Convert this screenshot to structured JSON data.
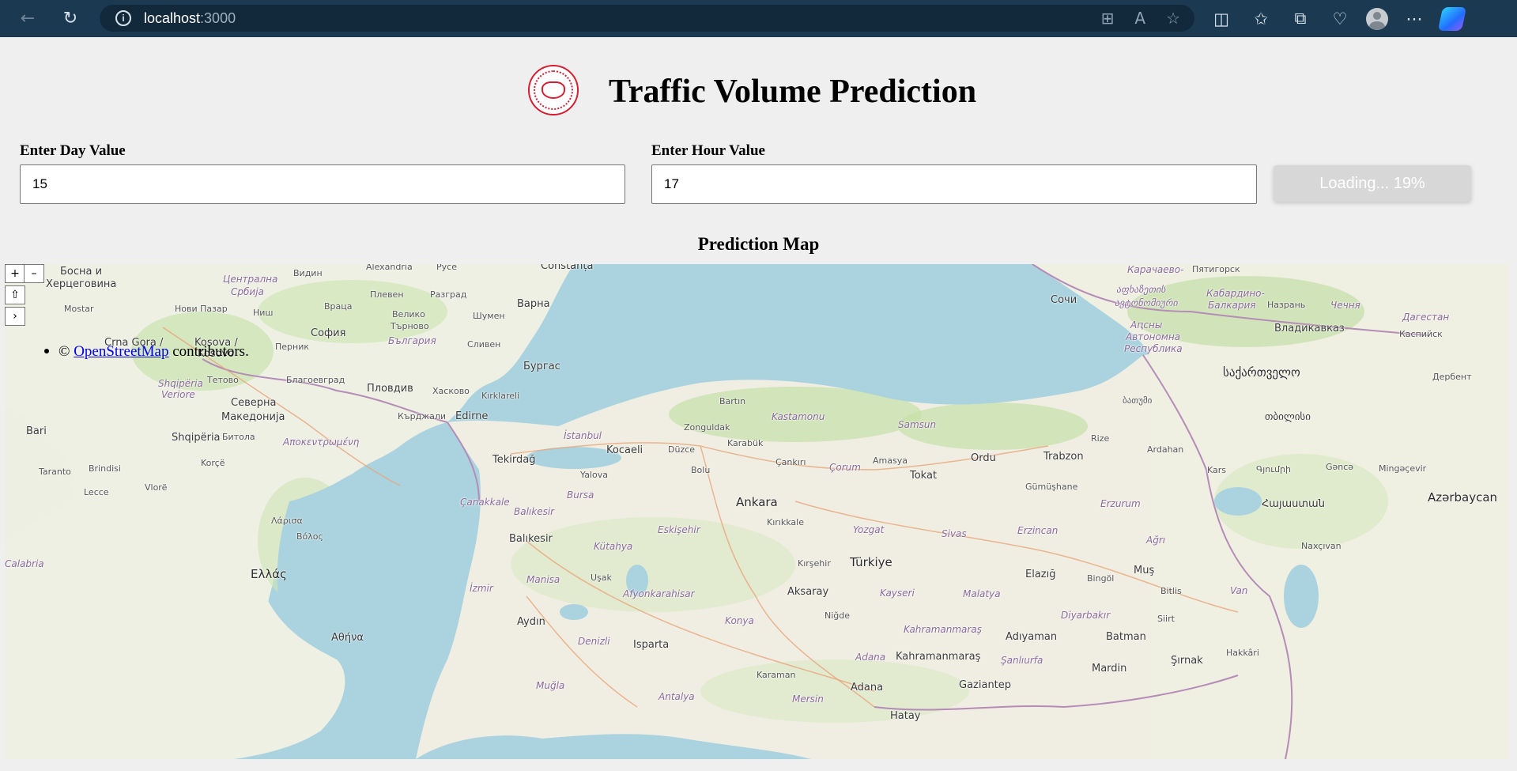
{
  "browser": {
    "url_host": "localhost",
    "url_port": ":3000",
    "icons": [
      "back-icon",
      "reload-icon",
      "site-info-icon",
      "apps-icon",
      "read-aloud-icon",
      "favorite-star-icon",
      "split-screen-icon",
      "favorites-icon",
      "collections-icon",
      "browser-essentials-icon",
      "profile-icon",
      "more-icon",
      "copilot-icon"
    ]
  },
  "header": {
    "title": "Traffic Volume Prediction"
  },
  "form": {
    "day_label": "Enter Day Value",
    "day_value": "15",
    "hour_label": "Enter Hour Value",
    "hour_value": "17",
    "button_label": "Loading... 19%",
    "progress_percent": 19
  },
  "map": {
    "heading": "Prediction Map",
    "zoom_in": "+",
    "zoom_out": "–",
    "reset": "⇧",
    "expand": "›",
    "attribution_prefix": "©",
    "attribution_link": "OpenStreetMap",
    "attribution_suffix": "contributors.",
    "places": [
      {
        "id": "bosna",
        "text": "Босна и",
        "cls": "med"
      },
      {
        "id": "hercegovina",
        "text": "Херцеговина",
        "cls": "med"
      },
      {
        "id": "centralna-srbija",
        "text": "Централна",
        "cls": "region"
      },
      {
        "id": "srbija",
        "text": "Србија",
        "cls": "region"
      },
      {
        "id": "vidin",
        "text": "Видин",
        "cls": "small"
      },
      {
        "id": "alexandria",
        "text": "Alexandria",
        "cls": "small"
      },
      {
        "id": "ruse",
        "text": "Русе",
        "cls": "small"
      },
      {
        "id": "constanta",
        "text": "Constanța",
        "cls": "med"
      },
      {
        "id": "mostar",
        "text": "Mostar",
        "cls": "small"
      },
      {
        "id": "novi-pazar",
        "text": "Нови Пазар",
        "cls": "small"
      },
      {
        "id": "nis",
        "text": "Ниш",
        "cls": "small"
      },
      {
        "id": "vraca",
        "text": "Враца",
        "cls": "small"
      },
      {
        "id": "pleven",
        "text": "Плевен",
        "cls": "small"
      },
      {
        "id": "razgrad",
        "text": "Разград",
        "cls": "small"
      },
      {
        "id": "varna",
        "text": "Варна",
        "cls": "med"
      },
      {
        "id": "veliko",
        "text": "Велико",
        "cls": "small"
      },
      {
        "id": "tarnovo",
        "text": "Търново",
        "cls": "small"
      },
      {
        "id": "shumen",
        "text": "Шумен",
        "cls": "small"
      },
      {
        "id": "sofia",
        "text": "София",
        "cls": "med"
      },
      {
        "id": "bulgaria",
        "text": "България",
        "cls": "region"
      },
      {
        "id": "crna-gora",
        "text": "Crna Gora /",
        "cls": "med"
      },
      {
        "id": "kosova",
        "text": "Kosova /",
        "cls": "med"
      },
      {
        "id": "kosovo",
        "text": "Kosovo",
        "cls": "med"
      },
      {
        "id": "pernik",
        "text": "Перник",
        "cls": "small"
      },
      {
        "id": "sliven",
        "text": "Сливен",
        "cls": "small"
      },
      {
        "id": "burgas",
        "text": "Бургас",
        "cls": "med"
      },
      {
        "id": "shqiperia-veriore",
        "text": "Shqipëria",
        "cls": "region"
      },
      {
        "id": "veriore",
        "text": "Veriore",
        "cls": "region"
      },
      {
        "id": "tetovo",
        "text": "Тетово",
        "cls": "small"
      },
      {
        "id": "blagoevgrad",
        "text": "Благоевград",
        "cls": "small"
      },
      {
        "id": "plovdiv",
        "text": "Пловдив",
        "cls": "med"
      },
      {
        "id": "haskovo",
        "text": "Хасково",
        "cls": "small"
      },
      {
        "id": "kirklareli",
        "text": "Kırklareli",
        "cls": "small"
      },
      {
        "id": "severna",
        "text": "Северна",
        "cls": "med"
      },
      {
        "id": "makedonija",
        "text": "Македонија",
        "cls": "med"
      },
      {
        "id": "kardzhali",
        "text": "Кърджали",
        "cls": "small"
      },
      {
        "id": "edirne",
        "text": "Edirne",
        "cls": "med"
      },
      {
        "id": "bartin",
        "text": "Bartın",
        "cls": "small"
      },
      {
        "id": "kastamonu",
        "text": "Kastamonu",
        "cls": "region"
      },
      {
        "id": "zonguldak",
        "text": "Zonguldak",
        "cls": "small"
      },
      {
        "id": "samsun",
        "text": "Samsun",
        "cls": "region"
      },
      {
        "id": "bari",
        "text": "Bari",
        "cls": "med"
      },
      {
        "id": "shqiperia",
        "text": "Shqipëria",
        "cls": "med"
      },
      {
        "id": "bitola",
        "text": "Битола",
        "cls": "small"
      },
      {
        "id": "apokentromeni",
        "text": "Αποκεντρωμένη",
        "cls": "region"
      },
      {
        "id": "istanbul",
        "text": "İstanbul",
        "cls": "region"
      },
      {
        "id": "karabuk",
        "text": "Karabük",
        "cls": "small"
      },
      {
        "id": "duzce",
        "text": "Düzce",
        "cls": "small"
      },
      {
        "id": "kocaeli",
        "text": "Kocaeli",
        "cls": "med"
      },
      {
        "id": "tekirdag",
        "text": "Tekirdağ",
        "cls": "med"
      },
      {
        "id": "cankiri",
        "text": "Çankırı",
        "cls": "small"
      },
      {
        "id": "corum",
        "text": "Çorum",
        "cls": "region"
      },
      {
        "id": "amasya",
        "text": "Amasya",
        "cls": "small"
      },
      {
        "id": "tokat",
        "text": "Tokat",
        "cls": "med"
      },
      {
        "id": "ordu",
        "text": "Ordu",
        "cls": "med"
      },
      {
        "id": "trabzon",
        "text": "Trabzon",
        "cls": "med"
      },
      {
        "id": "rize",
        "text": "Rize",
        "cls": "small"
      },
      {
        "id": "bolu",
        "text": "Bolu",
        "cls": "small"
      },
      {
        "id": "yalova",
        "text": "Yalova",
        "cls": "small"
      },
      {
        "id": "taranto",
        "text": "Taranto",
        "cls": "small"
      },
      {
        "id": "brindisi",
        "text": "Brindisi",
        "cls": "small"
      },
      {
        "id": "korce",
        "text": "Korçë",
        "cls": "small"
      },
      {
        "id": "vlore",
        "text": "Vlorë",
        "cls": "small"
      },
      {
        "id": "lecce",
        "text": "Lecce",
        "cls": "small"
      },
      {
        "id": "canakkale",
        "text": "Çanakkale",
        "cls": "region"
      },
      {
        "id": "bursa",
        "text": "Bursa",
        "cls": "region"
      },
      {
        "id": "balikesir-r",
        "text": "Balıkesir",
        "cls": "region"
      },
      {
        "id": "ankara",
        "text": "Ankara",
        "cls": "big"
      },
      {
        "id": "kirikkale",
        "text": "Kırıkkale",
        "cls": "small"
      },
      {
        "id": "gumushane",
        "text": "Gümüşhane",
        "cls": "small"
      },
      {
        "id": "erzurum",
        "text": "Erzurum",
        "cls": "region"
      },
      {
        "id": "ardahan",
        "text": "Ardahan",
        "cls": "small"
      },
      {
        "id": "kars",
        "text": "Kars",
        "cls": "small"
      },
      {
        "id": "gyumri",
        "text": "Գյումրի",
        "cls": "small"
      },
      {
        "id": "ganca",
        "text": "Gəncə",
        "cls": "small"
      },
      {
        "id": "mingecevir",
        "text": "Mingəçevir",
        "cls": "small"
      },
      {
        "id": "azarbaycan",
        "text": "Azərbaycan",
        "cls": "big"
      },
      {
        "id": "hayastan",
        "text": "Հայաստան",
        "cls": "med"
      },
      {
        "id": "eskisehir",
        "text": "Eskişehir",
        "cls": "region"
      },
      {
        "id": "yozgat",
        "text": "Yozgat",
        "cls": "region"
      },
      {
        "id": "sivas",
        "text": "Sivas",
        "cls": "region"
      },
      {
        "id": "erzincan",
        "text": "Erzincan",
        "cls": "region"
      },
      {
        "id": "kirsehir",
        "text": "Kırşehir",
        "cls": "small"
      },
      {
        "id": "turkiye",
        "text": "Türkiye",
        "cls": "big"
      },
      {
        "id": "agri",
        "text": "Ağrı",
        "cls": "region"
      },
      {
        "id": "nakhchivan",
        "text": "Naxçıvan",
        "cls": "small"
      },
      {
        "id": "balikesir",
        "text": "Balıkesir",
        "cls": "med"
      },
      {
        "id": "kutahya",
        "text": "Kütahya",
        "cls": "region"
      },
      {
        "id": "larisa",
        "text": "Λάρισα",
        "cls": "small"
      },
      {
        "id": "volos",
        "text": "Βόλος",
        "cls": "small"
      },
      {
        "id": "calabria",
        "text": "Calabria",
        "cls": "region"
      },
      {
        "id": "ellas",
        "text": "Ελλάς",
        "cls": "big"
      },
      {
        "id": "manisa",
        "text": "Manisa",
        "cls": "region"
      },
      {
        "id": "usak",
        "text": "Uşak",
        "cls": "small"
      },
      {
        "id": "afyonkarahisar",
        "text": "Afyonkarahisar",
        "cls": "region"
      },
      {
        "id": "izmir",
        "text": "İzmir",
        "cls": "region"
      },
      {
        "id": "aksaray",
        "text": "Aksaray",
        "cls": "med"
      },
      {
        "id": "kayseri",
        "text": "Kayseri",
        "cls": "region"
      },
      {
        "id": "malatya",
        "text": "Malatya",
        "cls": "region"
      },
      {
        "id": "elazig",
        "text": "Elazığ",
        "cls": "med"
      },
      {
        "id": "bingol",
        "text": "Bingöl",
        "cls": "small"
      },
      {
        "id": "mus",
        "text": "Muş",
        "cls": "med"
      },
      {
        "id": "bitlis",
        "text": "Bitlis",
        "cls": "small"
      },
      {
        "id": "van",
        "text": "Van",
        "cls": "region"
      },
      {
        "id": "athina",
        "text": "Αθήνα",
        "cls": "med"
      },
      {
        "id": "aydin",
        "text": "Aydın",
        "cls": "med"
      },
      {
        "id": "konya",
        "text": "Konya",
        "cls": "region"
      },
      {
        "id": "nigde",
        "text": "Niğde",
        "cls": "small"
      },
      {
        "id": "diyarbakir",
        "text": "Diyarbakır",
        "cls": "region"
      },
      {
        "id": "siirt",
        "text": "Siirt",
        "cls": "small"
      },
      {
        "id": "isparta",
        "text": "Isparta",
        "cls": "med"
      },
      {
        "id": "denizli",
        "text": "Denizli",
        "cls": "region"
      },
      {
        "id": "kahramanmaras-r",
        "text": "Kahramanmaraş",
        "cls": "region"
      },
      {
        "id": "adiyaman",
        "text": "Adıyaman",
        "cls": "med"
      },
      {
        "id": "batman",
        "text": "Batman",
        "cls": "med"
      },
      {
        "id": "hakkari",
        "text": "Hakkâri",
        "cls": "small"
      },
      {
        "id": "sanliurfa",
        "text": "Şanlıurfa",
        "cls": "region"
      },
      {
        "id": "sirnak",
        "text": "Şırnak",
        "cls": "med"
      },
      {
        "id": "mardin",
        "text": "Mardin",
        "cls": "med"
      },
      {
        "id": "karaman",
        "text": "Karaman",
        "cls": "small"
      },
      {
        "id": "adana-r",
        "text": "Adana",
        "cls": "region"
      },
      {
        "id": "kahramanmaras",
        "text": "Kahramanmaraş",
        "cls": "med"
      },
      {
        "id": "gaziantep",
        "text": "Gaziantep",
        "cls": "med"
      },
      {
        "id": "mugla",
        "text": "Muğla",
        "cls": "region"
      },
      {
        "id": "antalya",
        "text": "Antalya",
        "cls": "region"
      },
      {
        "id": "mersin",
        "text": "Mersin",
        "cls": "region"
      },
      {
        "id": "adana",
        "text": "Adana",
        "cls": "med"
      },
      {
        "id": "hatay",
        "text": "Hatay",
        "cls": "med"
      },
      {
        "id": "sochi",
        "text": "Сочи",
        "cls": "med"
      },
      {
        "id": "karachaevo",
        "text": "Карачаево-",
        "cls": "region"
      },
      {
        "id": "pyatigorsk",
        "text": "Пятигорск",
        "cls": "small"
      },
      {
        "id": "kabardino",
        "text": "Кабардино-",
        "cls": "region"
      },
      {
        "id": "balkaria",
        "text": "Балкария",
        "cls": "region"
      },
      {
        "id": "nazran",
        "text": "Назрань",
        "cls": "small"
      },
      {
        "id": "chechnya",
        "text": "Чечня",
        "cls": "region"
      },
      {
        "id": "dagestan",
        "text": "Дагестан",
        "cls": "region"
      },
      {
        "id": "kaspiysk",
        "text": "Каспийск",
        "cls": "small"
      },
      {
        "id": "vladikavkaz",
        "text": "Владикавказ",
        "cls": "med"
      },
      {
        "id": "abkhazia",
        "text": "აფხაზეთის",
        "cls": "region"
      },
      {
        "id": "abkhazia2",
        "text": "ავტონომიური",
        "cls": "region"
      },
      {
        "id": "sakartvelo",
        "text": "საქართველო",
        "cls": "big"
      },
      {
        "id": "derbent",
        "text": "Дербент",
        "cls": "small"
      },
      {
        "id": "batumi",
        "text": "ბათუმი",
        "cls": "small"
      },
      {
        "id": "tbilisi",
        "text": "თბილისი",
        "cls": "med"
      },
      {
        "id": "respublika",
        "text": "Республика",
        "cls": "region"
      },
      {
        "id": "avtonomna",
        "text": "Автономна",
        "cls": "region"
      },
      {
        "id": "alsny",
        "text": "Аԥсны",
        "cls": "region"
      }
    ]
  }
}
